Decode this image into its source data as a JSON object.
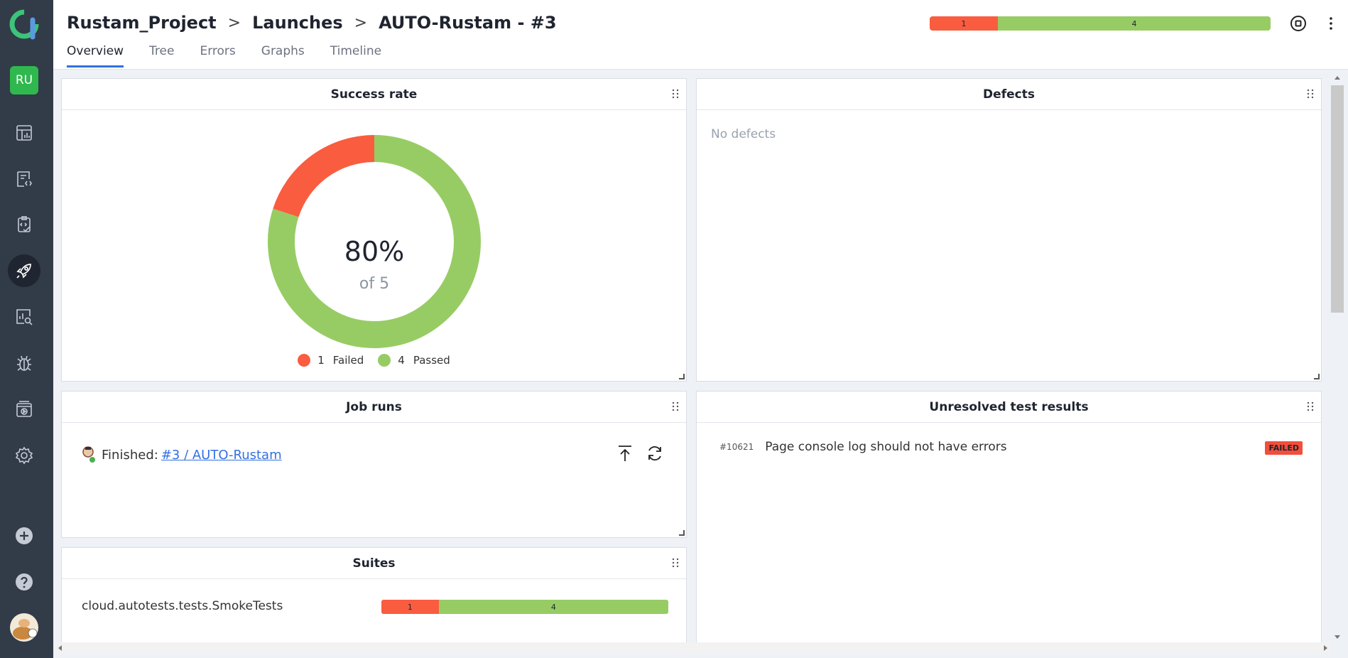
{
  "project": {
    "initials": "RU"
  },
  "breadcrumb": {
    "project": "Rustam_Project",
    "section": "Launches",
    "launch": "AUTO-Rustam - #3",
    "sep": ">"
  },
  "tabs": [
    "Overview",
    "Tree",
    "Errors",
    "Graphs",
    "Timeline"
  ],
  "header_bar": {
    "failed": 1,
    "passed": 4
  },
  "colors": {
    "failed": "#fa5c3f",
    "passed": "#97cc64",
    "accent": "#3370e0",
    "sidebar": "#323b48"
  },
  "success_rate": {
    "title": "Success rate",
    "percent_label": "80%",
    "of_label": "of 5",
    "legend": [
      {
        "count": "1",
        "label": "Failed"
      },
      {
        "count": "4",
        "label": "Passed"
      }
    ]
  },
  "chart_data": {
    "type": "pie",
    "title": "Success rate",
    "categories": [
      "Failed",
      "Passed"
    ],
    "values": [
      1,
      4
    ]
  },
  "defects": {
    "title": "Defects",
    "empty_text": "No defects"
  },
  "job_runs": {
    "title": "Job runs",
    "status": "Finished:",
    "link": "#3 / AUTO-Rustam"
  },
  "unresolved": {
    "title": "Unresolved test results",
    "id": "#10621",
    "name": "Page console log should not have errors",
    "status": "FAILED"
  },
  "suites": {
    "title": "Suites",
    "name": "cloud.autotests.tests.SmokeTests",
    "failed": 1,
    "passed": 4
  },
  "sidebar_icons": [
    "dashboard-icon",
    "test-cases-icon",
    "test-plans-icon",
    "launches-icon",
    "analytics-icon",
    "defects-icon",
    "jobs-icon",
    "settings-icon"
  ]
}
